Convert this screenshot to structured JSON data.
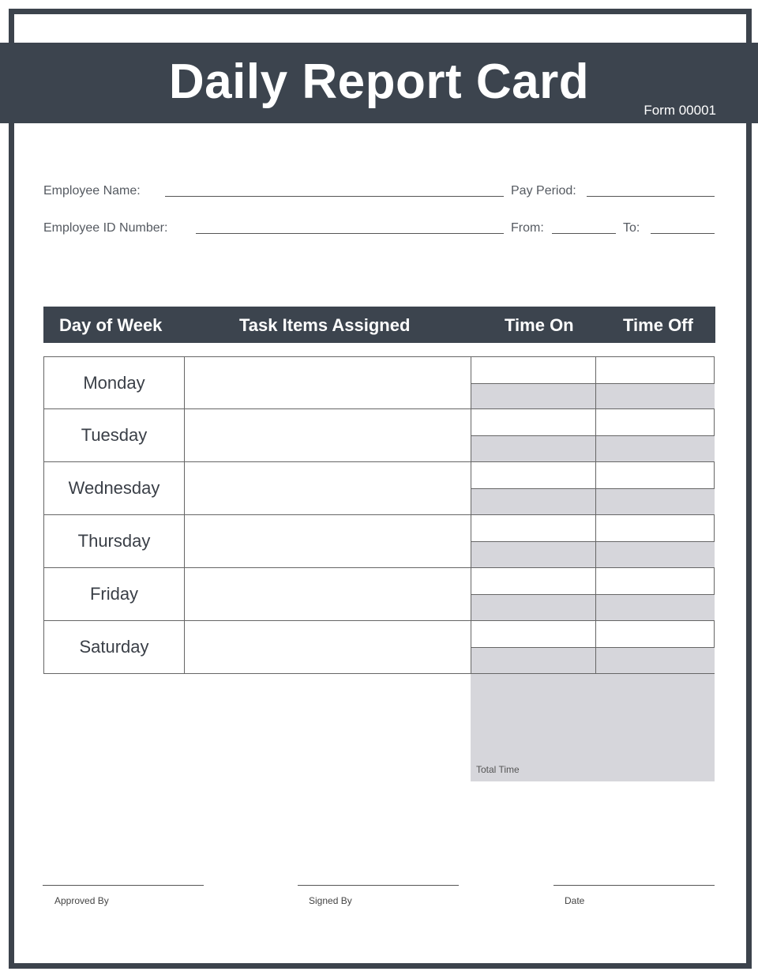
{
  "header": {
    "title": "Daily Report Card",
    "form_number": "Form 00001"
  },
  "fields": {
    "employee_name_label": "Employee Name:",
    "employee_name_value": "",
    "pay_period_label": "Pay Period:",
    "pay_period_value": "",
    "employee_id_label": "Employee ID Number:",
    "employee_id_value": "",
    "from_label": "From:",
    "from_value": "",
    "to_label": "To:",
    "to_value": ""
  },
  "table": {
    "columns": [
      "Day of Week",
      "Task Items Assigned",
      "Time On",
      "Time Off"
    ],
    "rows": [
      {
        "day": "Monday",
        "tasks": "",
        "time_on": "",
        "time_off": ""
      },
      {
        "day": "Tuesday",
        "tasks": "",
        "time_on": "",
        "time_off": ""
      },
      {
        "day": "Wednesday",
        "tasks": "",
        "time_on": "",
        "time_off": ""
      },
      {
        "day": "Thursday",
        "tasks": "",
        "time_on": "",
        "time_off": ""
      },
      {
        "day": "Friday",
        "tasks": "",
        "time_on": "",
        "time_off": ""
      },
      {
        "day": "Saturday",
        "tasks": "",
        "time_on": "",
        "time_off": ""
      }
    ],
    "total_label": "Total Time",
    "total_value": ""
  },
  "signatures": {
    "approved_by": "Approved By",
    "signed_by": "Signed By",
    "date": "Date"
  },
  "colors": {
    "header_bg": "#3c444e",
    "shaded_cell": "#d6d6db"
  }
}
